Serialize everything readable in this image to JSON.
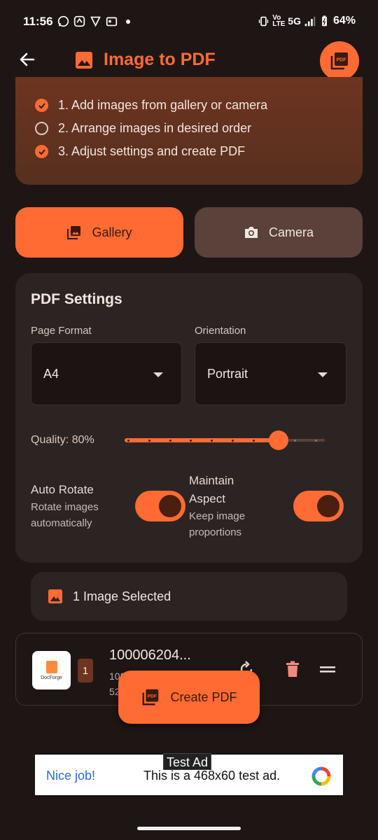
{
  "status_bar": {
    "time": "11:56",
    "volte": "Vo LTE",
    "network": "5G",
    "battery": "64%"
  },
  "app_bar": {
    "title": "Image to PDF",
    "action_icon": "pdf-icon",
    "action_badge": "PDF"
  },
  "steps": [
    {
      "text": "1. Add images from gallery or camera",
      "done": true
    },
    {
      "text": "2. Arrange images in desired order",
      "done": false
    },
    {
      "text": "3. Adjust settings and create PDF",
      "done": true
    }
  ],
  "sources": {
    "gallery_label": "Gallery",
    "camera_label": "Camera"
  },
  "settings": {
    "title": "PDF Settings",
    "page_format_label": "Page Format",
    "page_format_value": "A4",
    "orientation_label": "Orientation",
    "orientation_value": "Portrait",
    "quality_label": "Quality: 80%",
    "quality_value": 0.8,
    "auto_rotate_label": "Auto Rotate",
    "auto_rotate_sub": "Rotate images automatically",
    "auto_rotate_on": true,
    "maintain_aspect_label": "Maintain Aspect",
    "maintain_aspect_sub": "Keep image proportions",
    "maintain_aspect_on": true
  },
  "selection": {
    "summary": "1 Image Selected"
  },
  "image_item": {
    "index": "1",
    "name": "100006204...",
    "meta_line1": "1080×2400",
    "meta_line2": "52",
    "thumb_text": "DocForge"
  },
  "fab": {
    "label": "Create PDF",
    "badge": "PDF"
  },
  "ad": {
    "tag": "Test Ad",
    "left_text": "Nice job!",
    "main_text": "This is a 468x60 test ad."
  },
  "colors": {
    "accent": "#ff6b33",
    "background": "#1e1614",
    "card": "#2c2422",
    "camera_button": "#5a4139"
  }
}
